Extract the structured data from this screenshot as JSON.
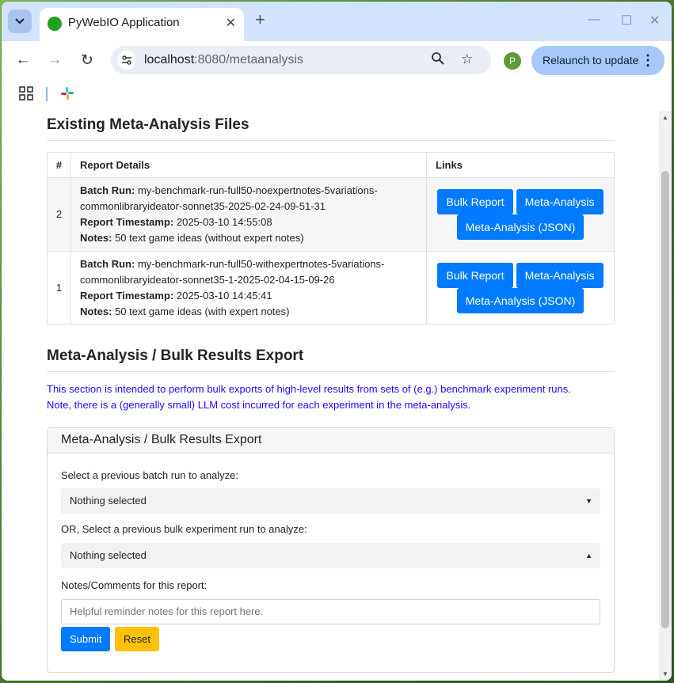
{
  "browser": {
    "tab_title": "PyWebIO Application",
    "url_host": "localhost",
    "url_rest": ":8080/metaanalysis",
    "profile_initial": "P",
    "relaunch_label": "Relaunch to update"
  },
  "files_section": {
    "title": "Existing Meta-Analysis Files",
    "columns": [
      "#",
      "Report Details",
      "Links"
    ],
    "rows": [
      {
        "num": "2",
        "batch_label": "Batch Run:",
        "batch_value_1": "my-benchmark-run-full50-noexpertnotes-5variations-",
        "batch_value_2": "commonlibraryideator-sonnet35-2025-02-24-09-51-31",
        "ts_label": "Report Timestamp:",
        "ts_value": "2025-03-10 14:55:08",
        "notes_label": "Notes:",
        "notes_value": "50 text game ideas (without expert notes)",
        "links": [
          "Bulk Report",
          "Meta-Analysis",
          "Meta-Analysis (JSON)"
        ]
      },
      {
        "num": "1",
        "batch_label": "Batch Run:",
        "batch_value_1": "my-benchmark-run-full50-withexpertnotes-5variations-",
        "batch_value_2": "commonlibraryideator-sonnet35-1-2025-02-04-15-09-26",
        "ts_label": "Report Timestamp:",
        "ts_value": "2025-03-10 14:45:41",
        "notes_label": "Notes:",
        "notes_value": "50 text game ideas (with expert notes)",
        "links": [
          "Bulk Report",
          "Meta-Analysis",
          "Meta-Analysis (JSON)"
        ]
      }
    ]
  },
  "export_section": {
    "title": "Meta-Analysis / Bulk Results Export",
    "intro_1": "This section is intended to perform bulk exports of high-level results from sets of (e.g.) benchmark experiment runs.",
    "intro_2": "Note, there is a (generally small) LLM cost incurred for each experiment in the meta-analysis.",
    "card_title": "Meta-Analysis / Bulk Results Export",
    "batch_label": "Select a previous batch run to analyze:",
    "batch_value": "Nothing selected",
    "bulk_label": "OR, Select a previous bulk experiment run to analyze:",
    "bulk_value": "Nothing selected",
    "notes_label": "Notes/Comments for this report:",
    "notes_placeholder": "Helpful reminder notes for this report here.",
    "submit_label": "Submit",
    "reset_label": "Reset"
  }
}
